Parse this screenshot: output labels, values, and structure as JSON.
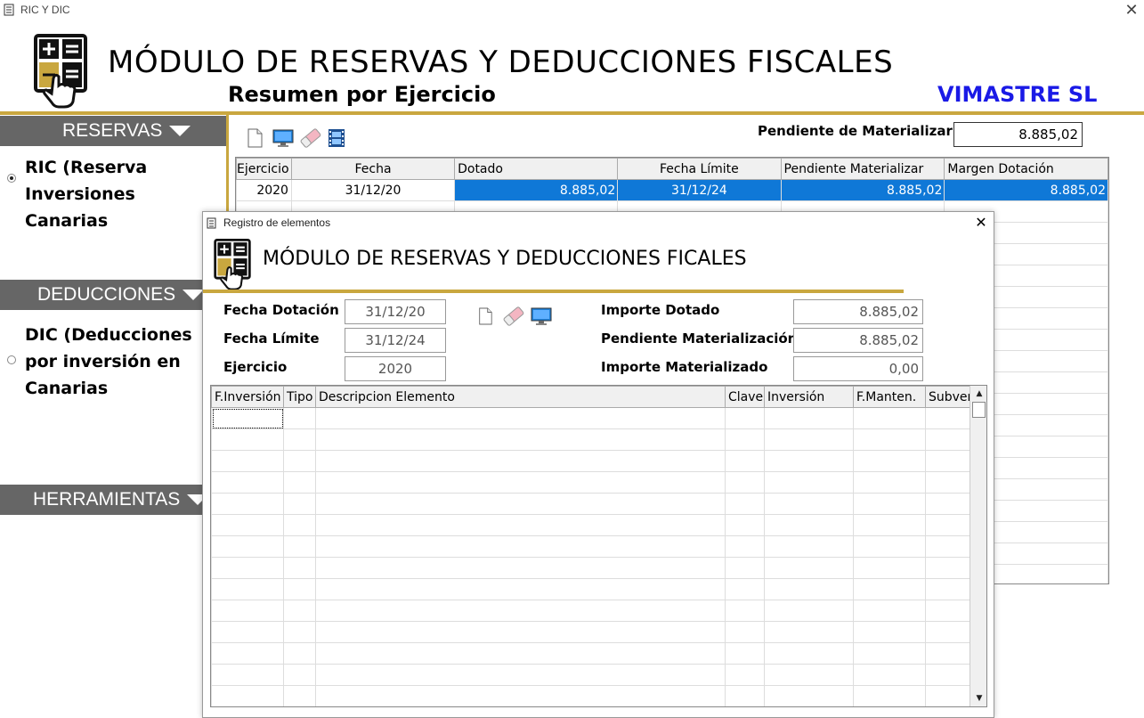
{
  "window": {
    "title": "RIC Y DIC",
    "close_glyph": "✕"
  },
  "header": {
    "title": "MÓDULO DE RESERVAS Y DEDUCCIONES FISCALES",
    "subtitle": "Resumen por Ejercicio",
    "company": "VIMASTRE SL"
  },
  "colors": {
    "gold": "#c9a73f",
    "sidebar_header": "#666666",
    "selection": "#0f78d7",
    "company": "#1a1ae6"
  },
  "sidebar": {
    "reservas": {
      "label": "RESERVAS",
      "item": "RIC (Reserva Inversiones Canarias"
    },
    "deducciones": {
      "label": "DEDUCCIONES",
      "item": "DIC (Deducciones por inversión en Canarias"
    },
    "herramientas": {
      "label": "HERRAMIENTAS"
    }
  },
  "toolbar": {
    "icons": [
      "new-document-icon",
      "monitor-icon",
      "eraser-icon",
      "film-icon"
    ]
  },
  "pendiente": {
    "label": "Pendiente de Materializar",
    "value": "8.885,02"
  },
  "main_grid": {
    "columns": [
      "Ejercicio",
      "Fecha",
      "Dotado",
      "Fecha Límite",
      "Pendiente Materializar",
      "Margen Dotación"
    ],
    "rows": [
      [
        "2020",
        "31/12/20",
        "8.885,02",
        "31/12/24",
        "8.885,02",
        "8.885,02"
      ]
    ]
  },
  "dialog": {
    "title": "Registro de elementos",
    "close_glyph": "✕",
    "module_title": "MÓDULO DE RESERVAS Y DEDUCCIONES FICALES",
    "fields": {
      "fecha_dotacion": {
        "label": "Fecha Dotación",
        "value": "31/12/20"
      },
      "fecha_limite": {
        "label": "Fecha Límite",
        "value": "31/12/24"
      },
      "ejercicio": {
        "label": "Ejercicio",
        "value": "2020"
      },
      "importe_dotado": {
        "label": "Importe Dotado",
        "value": "8.885,02"
      },
      "pendiente_materializacion": {
        "label": "Pendiente Materialización",
        "value": "8.885,02"
      },
      "importe_materializado": {
        "label": "Importe Materializado",
        "value": "0,00"
      }
    },
    "toolbar": {
      "icons": [
        "new-document-icon",
        "eraser-icon",
        "monitor-icon"
      ]
    },
    "grid": {
      "columns": [
        "F.Inversión",
        "Tipo",
        "Descripcion Elemento",
        "Clave",
        "Inversión",
        "F.Manten.",
        "Subvenc"
      ]
    }
  }
}
